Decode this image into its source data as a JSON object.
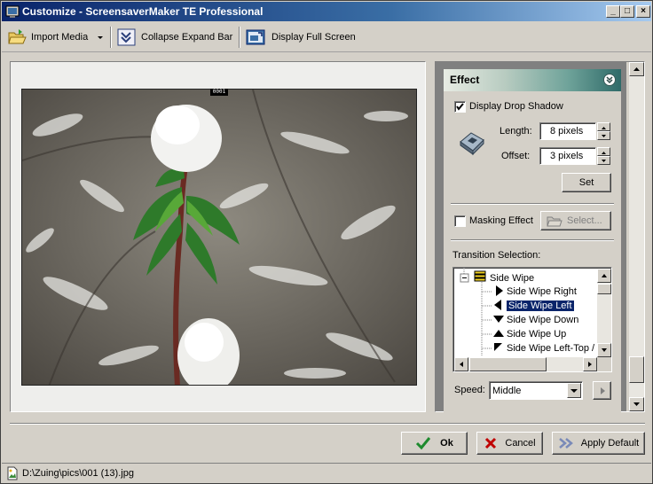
{
  "window": {
    "title": "Customize - ScreensaverMaker TE Professional",
    "controls": {
      "minimize": "_",
      "maximize": "□",
      "close": "×"
    }
  },
  "toolbar": {
    "import_media": "Import Media",
    "collapse_expand": "Collapse Expand Bar",
    "display_full_screen": "Display Full Screen"
  },
  "preview": {
    "overlay_label": "0001"
  },
  "effect_panel": {
    "title": "Effect",
    "drop_shadow": {
      "label": "Display Drop Shadow",
      "checked": true,
      "length_label": "Length:",
      "length_value": "8 pixels",
      "offset_label": "Offset:",
      "offset_value": "3 pixels",
      "set_button": "Set"
    },
    "masking": {
      "label": "Masking Effect",
      "checked": false,
      "select_button": "Select..."
    },
    "transition": {
      "label": "Transition Selection:",
      "parent": "Side Wipe",
      "items": [
        {
          "label": "Side Wipe Right",
          "icon": "arrow-right-icon",
          "selected": false
        },
        {
          "label": "Side Wipe Left",
          "icon": "arrow-left-icon",
          "selected": true
        },
        {
          "label": "Side Wipe Down",
          "icon": "arrow-down-icon",
          "selected": false
        },
        {
          "label": "Side Wipe Up",
          "icon": "arrow-up-icon",
          "selected": false
        },
        {
          "label": "Side Wipe Left-Top /",
          "icon": "arrow-diagonal-icon",
          "selected": false
        }
      ]
    },
    "speed": {
      "label": "Speed:",
      "value": "Middle"
    }
  },
  "buttons": {
    "ok": "Ok",
    "cancel": "Cancel",
    "apply_default": "Apply Default"
  },
  "status": {
    "path": "D:\\Zuing\\pics\\001 (13).jpg"
  },
  "colors": {
    "title_active": "#0a246a",
    "selection": "#0a246a",
    "ok_check": "#1e8a2e",
    "cancel_x": "#c00000",
    "panel_teal": "#2e6a68"
  }
}
